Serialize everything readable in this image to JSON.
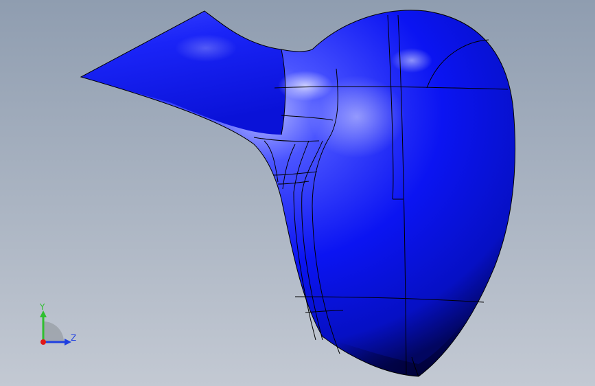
{
  "viewport": {
    "background_top": "#8f9db0",
    "background_bottom": "#c3c9d3",
    "model_color": "#0b14f2",
    "model_highlight": "#aab0ff",
    "edge_color": "#000000"
  },
  "triad": {
    "y_label": "Y",
    "z_label": "Z",
    "y_color": "#2fbf2f",
    "z_color": "#1f3fe0",
    "origin_color": "#e01818"
  }
}
